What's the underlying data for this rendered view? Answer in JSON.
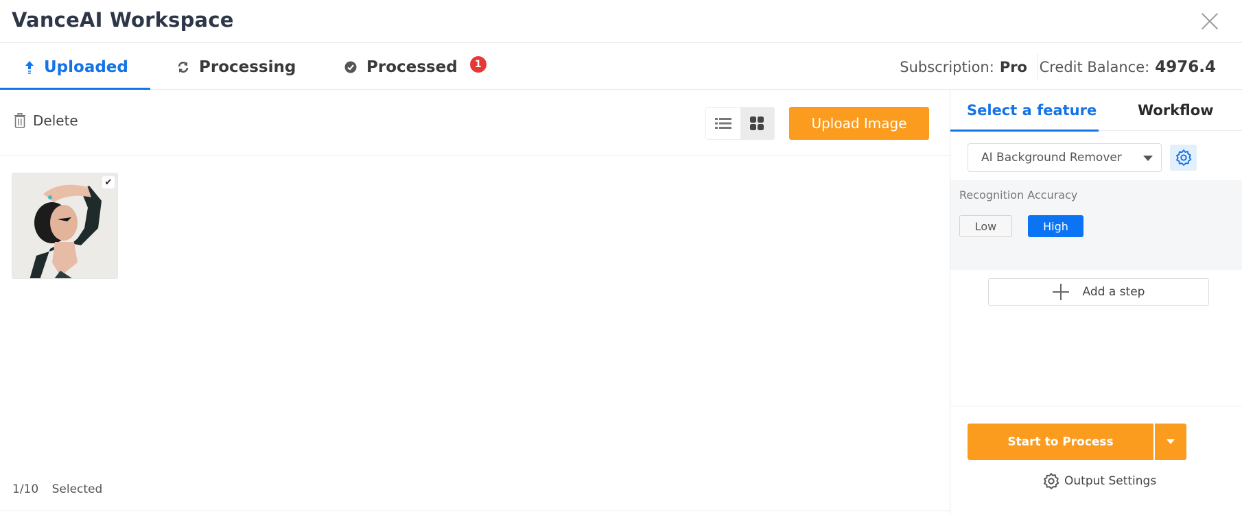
{
  "header": {
    "title": "VanceAI Workspace",
    "close_icon": "close-icon"
  },
  "tabs": [
    {
      "label": "Uploaded",
      "icon": "upload-arrow-icon",
      "active": true
    },
    {
      "label": "Processing",
      "icon": "refresh-icon",
      "active": false
    },
    {
      "label": "Processed",
      "icon": "check-circle-icon",
      "active": false,
      "badge": "1"
    }
  ],
  "account": {
    "subscription_label": "Subscription:",
    "subscription_value": "Pro",
    "credit_label": "Credit Balance:",
    "credit_value": "4976.4"
  },
  "toolbar": {
    "delete_label": "Delete",
    "view_modes": [
      "list",
      "grid"
    ],
    "active_view": "grid",
    "upload_label": "Upload Image"
  },
  "images": [
    {
      "alt": "Woman with hand on forehead, black jacket",
      "selected": true
    }
  ],
  "selection": {
    "count": "1/10",
    "label": "Selected"
  },
  "feature_panel": {
    "tabs": [
      {
        "label": "Select a feature",
        "active": true
      },
      {
        "label": "Workflow",
        "active": false
      }
    ],
    "feature_value": "AI Background Remover",
    "option_label": "Recognition Accuracy",
    "options": [
      {
        "label": "Low",
        "selected": false
      },
      {
        "label": "High",
        "selected": true
      }
    ],
    "add_step_label": "Add a step",
    "start_label": "Start to Process",
    "output_settings_label": "Output Settings"
  },
  "colors": {
    "accent": "#1473e6",
    "primary_action": "#fb9c1f",
    "selected_option": "#0a74f5",
    "badge": "#e53935"
  }
}
